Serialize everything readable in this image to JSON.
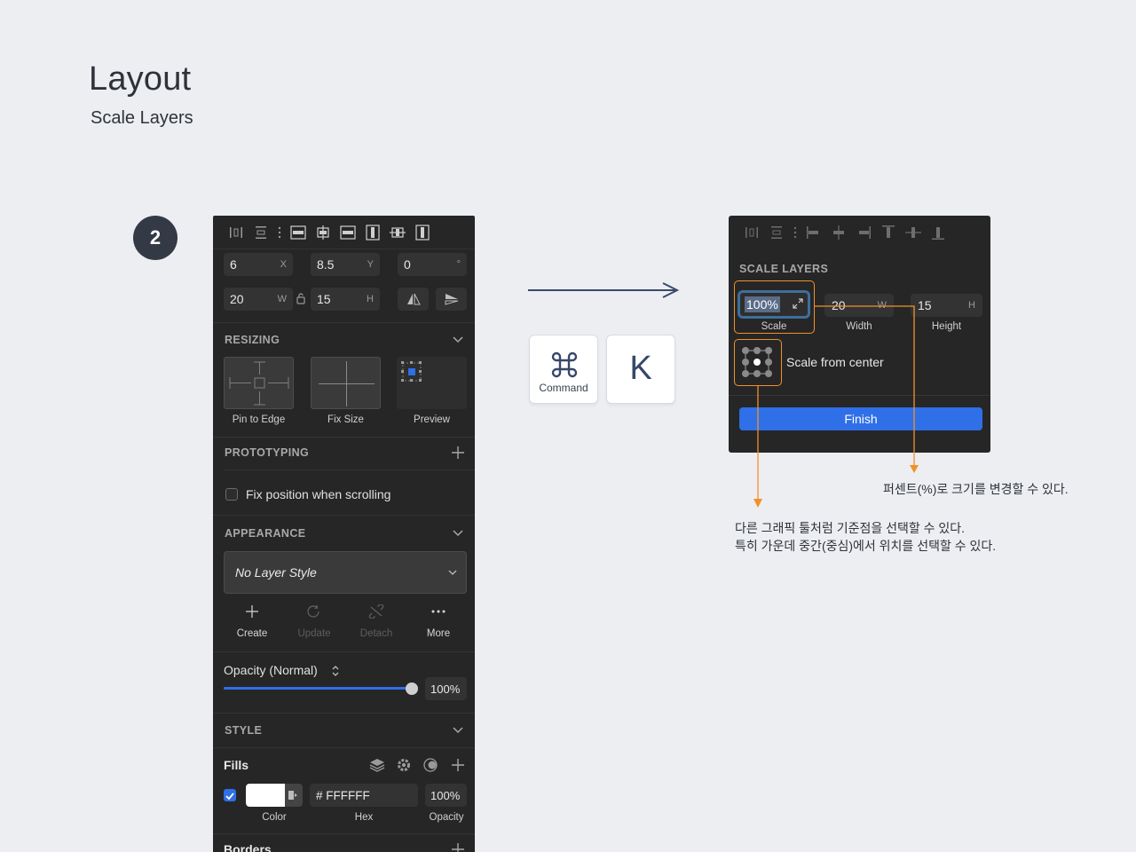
{
  "page": {
    "title": "Layout",
    "subtitle": "Scale Layers",
    "step": "2"
  },
  "colors": {
    "accent": "#2f6fe8",
    "highlight": "#f0922a",
    "panel": "#262626",
    "arrow": "#3a4a6b"
  },
  "inspector": {
    "position": {
      "x": {
        "value": "6",
        "suffix": "X"
      },
      "y": {
        "value": "8.5",
        "suffix": "Y"
      },
      "rotation": {
        "value": "0",
        "suffix": "°"
      },
      "width": {
        "value": "20",
        "suffix": "W"
      },
      "height": {
        "value": "15",
        "suffix": "H"
      }
    },
    "resizing": {
      "title": "RESIZING",
      "boxes": [
        "Pin to Edge",
        "Fix Size",
        "Preview"
      ]
    },
    "prototyping": {
      "title": "PROTOTYPING",
      "fix_position_label": "Fix position when scrolling"
    },
    "appearance": {
      "title": "APPEARANCE",
      "layer_style": "No Layer Style",
      "actions": {
        "create": "Create",
        "update": "Update",
        "detach": "Detach",
        "more": "More"
      },
      "opacity_label": "Opacity (Normal)",
      "opacity_value": "100%"
    },
    "style": {
      "title": "STYLE",
      "fills_label": "Fills",
      "fill": {
        "hex": "# FFFFFF",
        "opacity": "100%",
        "color_label": "Color",
        "hex_label": "Hex",
        "opacity_label": "Opacity"
      },
      "borders_label": "Borders"
    }
  },
  "shortcut": {
    "command_label": "Command",
    "key": "K"
  },
  "dialog": {
    "title": "SCALE LAYERS",
    "scale": {
      "value": "100%",
      "label": "Scale"
    },
    "width": {
      "value": "20",
      "suffix": "W",
      "label": "Width"
    },
    "height": {
      "value": "15",
      "suffix": "H",
      "label": "Height"
    },
    "scale_from_center": "Scale from center",
    "finish": "Finish"
  },
  "notes": {
    "percent": "퍼센트(%)로 크기를 변경할 수 있다.",
    "anchor_line1": "다른 그래픽 툴처럼 기준점을 선택할 수 있다.",
    "anchor_line2": "특히 가운데 중간(중심)에서 위치를 선택할 수 있다."
  }
}
